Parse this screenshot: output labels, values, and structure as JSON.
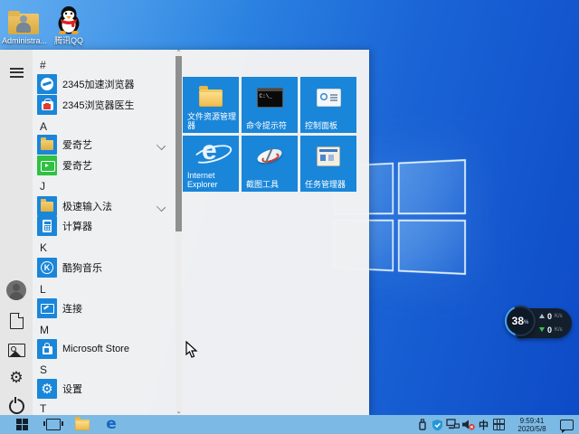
{
  "desktop": {
    "icons": [
      {
        "label": "Administra..."
      },
      {
        "label": "腾讯QQ"
      }
    ]
  },
  "widget": {
    "percent": "38",
    "percent_unit": "%",
    "up_value": "0",
    "up_unit": "K/s",
    "down_value": "0",
    "down_unit": "K/s"
  },
  "start_menu": {
    "rows": [
      {
        "label": "#"
      },
      {
        "label": "2345加速浏览器"
      },
      {
        "label": "2345浏览器医生"
      },
      {
        "label": "A"
      },
      {
        "label": "爱奇艺"
      },
      {
        "label": "爱奇艺"
      },
      {
        "label": "J"
      },
      {
        "label": "极速输入法"
      },
      {
        "label": "计算器"
      },
      {
        "label": "K"
      },
      {
        "label": "酷狗音乐"
      },
      {
        "label": "L"
      },
      {
        "label": "连接"
      },
      {
        "label": "M"
      },
      {
        "label": "Microsoft Store"
      },
      {
        "label": "S"
      },
      {
        "label": "设置"
      },
      {
        "label": "T"
      }
    ],
    "tiles": [
      {
        "label": "文件资源管理器"
      },
      {
        "label": "命令提示符"
      },
      {
        "label": "控制面板"
      },
      {
        "label": "Internet Explorer"
      },
      {
        "label": "截图工具"
      },
      {
        "label": "任务管理器"
      }
    ],
    "glyphs": {
      "cmd_text": "C:\\_",
      "ie_letter": "e",
      "kugou_letter": "K",
      "gear_char": "⚙"
    }
  },
  "taskbar": {
    "ime_label": "中",
    "clock": {
      "time": "9:59:41",
      "date": "2020/5/8"
    }
  }
}
